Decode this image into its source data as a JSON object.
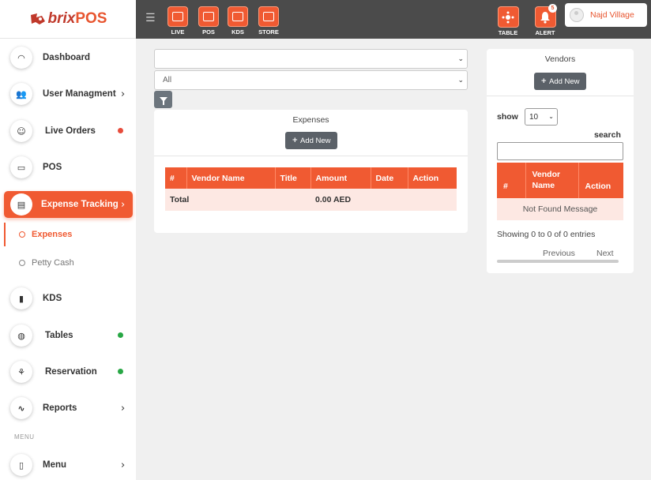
{
  "brand": {
    "logo_text_1": "brix",
    "logo_text_2": "POS"
  },
  "topnav": {
    "buttons": [
      {
        "label": "LIVE"
      },
      {
        "label": "POS"
      },
      {
        "label": "KDS"
      },
      {
        "label": "STORE"
      },
      {
        "label": "TABLE"
      },
      {
        "label": "ALERT",
        "badge": "5"
      }
    ],
    "user_name": "Najd Village"
  },
  "sidebar": {
    "items": [
      {
        "label": "Dashboard",
        "icon": "gauge-icon"
      },
      {
        "label": "User Managment",
        "icon": "users-icon"
      },
      {
        "label": "Live Orders",
        "icon": "headset-icon",
        "status_color": "#e74c3c"
      },
      {
        "label": "POS",
        "icon": "monitor-icon"
      },
      {
        "label": "Expense Tracking",
        "icon": "receipt-icon"
      },
      {
        "label": "KDS",
        "icon": "chef-icon"
      },
      {
        "label": "Tables",
        "icon": "table-icon",
        "status_color": "#28a745"
      },
      {
        "label": "Reservation",
        "icon": "reservation-icon",
        "status_color": "#28a745"
      },
      {
        "label": "Reports",
        "icon": "pulse-icon"
      },
      {
        "label": "Menu",
        "icon": "clipboard-icon"
      }
    ],
    "subitems": [
      {
        "label": "Expenses"
      },
      {
        "label": "Petty Cash"
      }
    ],
    "section_heading": "MENU"
  },
  "filters": {
    "vendor_select": "",
    "status_select": "All"
  },
  "expenses": {
    "title": "Expenses",
    "add_label": "Add New",
    "columns": [
      "#",
      "Vendor Name",
      "Title",
      "Amount",
      "Date",
      "Action"
    ],
    "total_label": "Total",
    "total_amount": "0.00 AED"
  },
  "vendors": {
    "title": "Vendors",
    "add_label": "Add New",
    "show_label": "show",
    "page_length": "10",
    "search_label": "search",
    "columns": [
      "#",
      "Vendor Name",
      "Action"
    ],
    "empty_message": "Not Found Message",
    "info": "Showing 0 to 0 of 0 entries",
    "prev_label": "Previous",
    "next_label": "Next"
  },
  "colors": {
    "accent": "#f05a32",
    "navbar": "#4b4b4b",
    "button_gray": "#5b6168"
  }
}
